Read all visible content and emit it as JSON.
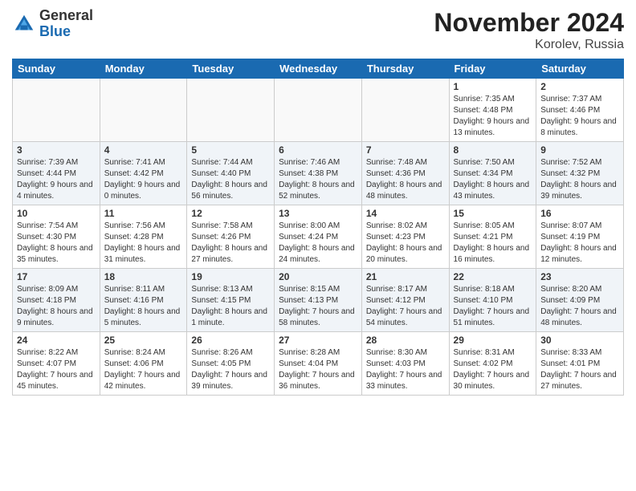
{
  "header": {
    "logo_general": "General",
    "logo_blue": "Blue",
    "month_title": "November 2024",
    "location": "Korolev, Russia"
  },
  "weekdays": [
    "Sunday",
    "Monday",
    "Tuesday",
    "Wednesday",
    "Thursday",
    "Friday",
    "Saturday"
  ],
  "weeks": [
    [
      {
        "num": "",
        "sunrise": "",
        "sunset": "",
        "daylight": ""
      },
      {
        "num": "",
        "sunrise": "",
        "sunset": "",
        "daylight": ""
      },
      {
        "num": "",
        "sunrise": "",
        "sunset": "",
        "daylight": ""
      },
      {
        "num": "",
        "sunrise": "",
        "sunset": "",
        "daylight": ""
      },
      {
        "num": "",
        "sunrise": "",
        "sunset": "",
        "daylight": ""
      },
      {
        "num": "1",
        "sunrise": "Sunrise: 7:35 AM",
        "sunset": "Sunset: 4:48 PM",
        "daylight": "Daylight: 9 hours and 13 minutes."
      },
      {
        "num": "2",
        "sunrise": "Sunrise: 7:37 AM",
        "sunset": "Sunset: 4:46 PM",
        "daylight": "Daylight: 9 hours and 8 minutes."
      }
    ],
    [
      {
        "num": "3",
        "sunrise": "Sunrise: 7:39 AM",
        "sunset": "Sunset: 4:44 PM",
        "daylight": "Daylight: 9 hours and 4 minutes."
      },
      {
        "num": "4",
        "sunrise": "Sunrise: 7:41 AM",
        "sunset": "Sunset: 4:42 PM",
        "daylight": "Daylight: 9 hours and 0 minutes."
      },
      {
        "num": "5",
        "sunrise": "Sunrise: 7:44 AM",
        "sunset": "Sunset: 4:40 PM",
        "daylight": "Daylight: 8 hours and 56 minutes."
      },
      {
        "num": "6",
        "sunrise": "Sunrise: 7:46 AM",
        "sunset": "Sunset: 4:38 PM",
        "daylight": "Daylight: 8 hours and 52 minutes."
      },
      {
        "num": "7",
        "sunrise": "Sunrise: 7:48 AM",
        "sunset": "Sunset: 4:36 PM",
        "daylight": "Daylight: 8 hours and 48 minutes."
      },
      {
        "num": "8",
        "sunrise": "Sunrise: 7:50 AM",
        "sunset": "Sunset: 4:34 PM",
        "daylight": "Daylight: 8 hours and 43 minutes."
      },
      {
        "num": "9",
        "sunrise": "Sunrise: 7:52 AM",
        "sunset": "Sunset: 4:32 PM",
        "daylight": "Daylight: 8 hours and 39 minutes."
      }
    ],
    [
      {
        "num": "10",
        "sunrise": "Sunrise: 7:54 AM",
        "sunset": "Sunset: 4:30 PM",
        "daylight": "Daylight: 8 hours and 35 minutes."
      },
      {
        "num": "11",
        "sunrise": "Sunrise: 7:56 AM",
        "sunset": "Sunset: 4:28 PM",
        "daylight": "Daylight: 8 hours and 31 minutes."
      },
      {
        "num": "12",
        "sunrise": "Sunrise: 7:58 AM",
        "sunset": "Sunset: 4:26 PM",
        "daylight": "Daylight: 8 hours and 27 minutes."
      },
      {
        "num": "13",
        "sunrise": "Sunrise: 8:00 AM",
        "sunset": "Sunset: 4:24 PM",
        "daylight": "Daylight: 8 hours and 24 minutes."
      },
      {
        "num": "14",
        "sunrise": "Sunrise: 8:02 AM",
        "sunset": "Sunset: 4:23 PM",
        "daylight": "Daylight: 8 hours and 20 minutes."
      },
      {
        "num": "15",
        "sunrise": "Sunrise: 8:05 AM",
        "sunset": "Sunset: 4:21 PM",
        "daylight": "Daylight: 8 hours and 16 minutes."
      },
      {
        "num": "16",
        "sunrise": "Sunrise: 8:07 AM",
        "sunset": "Sunset: 4:19 PM",
        "daylight": "Daylight: 8 hours and 12 minutes."
      }
    ],
    [
      {
        "num": "17",
        "sunrise": "Sunrise: 8:09 AM",
        "sunset": "Sunset: 4:18 PM",
        "daylight": "Daylight: 8 hours and 9 minutes."
      },
      {
        "num": "18",
        "sunrise": "Sunrise: 8:11 AM",
        "sunset": "Sunset: 4:16 PM",
        "daylight": "Daylight: 8 hours and 5 minutes."
      },
      {
        "num": "19",
        "sunrise": "Sunrise: 8:13 AM",
        "sunset": "Sunset: 4:15 PM",
        "daylight": "Daylight: 8 hours and 1 minute."
      },
      {
        "num": "20",
        "sunrise": "Sunrise: 8:15 AM",
        "sunset": "Sunset: 4:13 PM",
        "daylight": "Daylight: 7 hours and 58 minutes."
      },
      {
        "num": "21",
        "sunrise": "Sunrise: 8:17 AM",
        "sunset": "Sunset: 4:12 PM",
        "daylight": "Daylight: 7 hours and 54 minutes."
      },
      {
        "num": "22",
        "sunrise": "Sunrise: 8:18 AM",
        "sunset": "Sunset: 4:10 PM",
        "daylight": "Daylight: 7 hours and 51 minutes."
      },
      {
        "num": "23",
        "sunrise": "Sunrise: 8:20 AM",
        "sunset": "Sunset: 4:09 PM",
        "daylight": "Daylight: 7 hours and 48 minutes."
      }
    ],
    [
      {
        "num": "24",
        "sunrise": "Sunrise: 8:22 AM",
        "sunset": "Sunset: 4:07 PM",
        "daylight": "Daylight: 7 hours and 45 minutes."
      },
      {
        "num": "25",
        "sunrise": "Sunrise: 8:24 AM",
        "sunset": "Sunset: 4:06 PM",
        "daylight": "Daylight: 7 hours and 42 minutes."
      },
      {
        "num": "26",
        "sunrise": "Sunrise: 8:26 AM",
        "sunset": "Sunset: 4:05 PM",
        "daylight": "Daylight: 7 hours and 39 minutes."
      },
      {
        "num": "27",
        "sunrise": "Sunrise: 8:28 AM",
        "sunset": "Sunset: 4:04 PM",
        "daylight": "Daylight: 7 hours and 36 minutes."
      },
      {
        "num": "28",
        "sunrise": "Sunrise: 8:30 AM",
        "sunset": "Sunset: 4:03 PM",
        "daylight": "Daylight: 7 hours and 33 minutes."
      },
      {
        "num": "29",
        "sunrise": "Sunrise: 8:31 AM",
        "sunset": "Sunset: 4:02 PM",
        "daylight": "Daylight: 7 hours and 30 minutes."
      },
      {
        "num": "30",
        "sunrise": "Sunrise: 8:33 AM",
        "sunset": "Sunset: 4:01 PM",
        "daylight": "Daylight: 7 hours and 27 minutes."
      }
    ]
  ]
}
